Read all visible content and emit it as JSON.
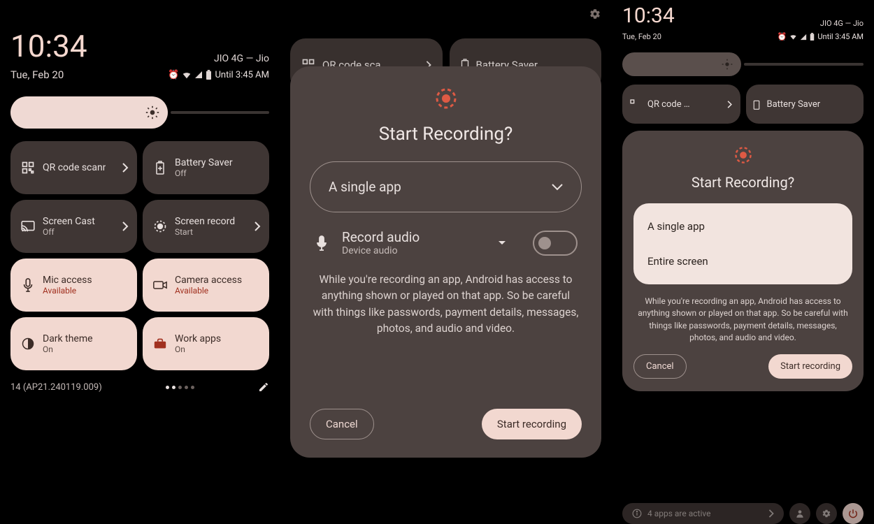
{
  "colors": {
    "accent": "#f2d8d0",
    "tile": "#3f3634",
    "dialog": "#4c4240",
    "rec": "#de5a44"
  },
  "panel1": {
    "time": "10:34",
    "network": "JIO 4G — Jio",
    "date": "Tue, Feb 20",
    "until": "Until 3:45 AM",
    "build": "14 (AP21.240119.009)",
    "tiles": [
      {
        "label": "QR code scanner",
        "sub": "",
        "chevron": true
      },
      {
        "label": "Battery Saver",
        "sub": "Off"
      },
      {
        "label": "Screen Cast",
        "sub": "Off",
        "chevron": true
      },
      {
        "label": "Screen record",
        "sub": "Start",
        "chevron": true
      },
      {
        "label": "Mic access",
        "sub": "Available",
        "on": true
      },
      {
        "label": "Camera access",
        "sub": "Available",
        "on": true
      },
      {
        "label": "Dark theme",
        "sub": "On",
        "on": true,
        "neutral": true
      },
      {
        "label": "Work apps",
        "sub": "On",
        "on": true,
        "neutral": true
      }
    ]
  },
  "panel2": {
    "bg_tiles": [
      {
        "label": "QR code sca…"
      },
      {
        "label": "Battery Saver"
      }
    ],
    "dialog": {
      "title": "Start Recording?",
      "dropdown": "A single app",
      "audio_title": "Record audio",
      "audio_sub": "Device audio",
      "audio_on": false,
      "warning": "While you're recording an app, Android has access to anything shown or played on that app. So be careful with things like passwords, payment details, messages, photos, and audio and video.",
      "cancel": "Cancel",
      "confirm": "Start recording"
    }
  },
  "panel3": {
    "time": "10:34",
    "network": "JIO 4G — Jio",
    "date": "Tue, Feb 20",
    "until": "Until 3:45 AM",
    "bg_tiles": [
      {
        "label": "QR code …"
      },
      {
        "label": "Battery Saver"
      }
    ],
    "dialog": {
      "title": "Start Recording?",
      "options": [
        "A single app",
        "Entire screen"
      ],
      "warning": "While you're recording an app, Android has access to anything shown or played on that app. So be careful with things like passwords, payment details, messages, photos, and audio and video.",
      "cancel": "Cancel",
      "confirm": "Start recording"
    },
    "bottom": {
      "apps_active": "4 apps are active"
    }
  }
}
